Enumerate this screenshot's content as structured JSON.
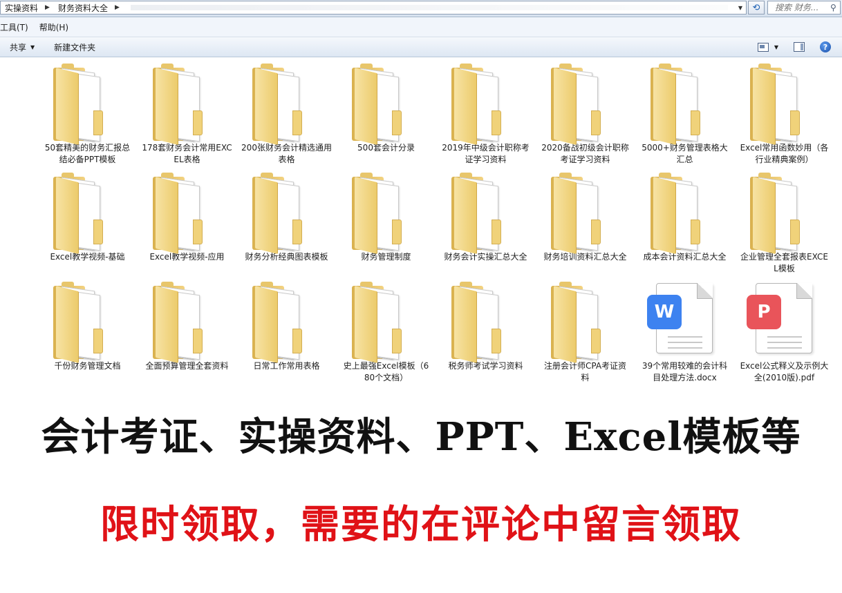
{
  "window": {
    "breadcrumbs": [
      "实操资料",
      "财务资料大全"
    ],
    "search_placeholder": "搜索 财务..."
  },
  "menubar": [
    "工具(T)",
    "帮助(H)"
  ],
  "toolbar": {
    "share_label": "共享",
    "new_folder_label": "新建文件夹"
  },
  "items": [
    {
      "label": "50套精美的财务汇报总结必备PPT模板",
      "type": "folder"
    },
    {
      "label": "178套财务会计常用EXCEL表格",
      "type": "folder"
    },
    {
      "label": "200张财务会计精选通用表格",
      "type": "folder"
    },
    {
      "label": "500套会计分录",
      "type": "folder"
    },
    {
      "label": "2019年中级会计职称考证学习资料",
      "type": "folder"
    },
    {
      "label": "2020备战初级会计职称考证学习资料",
      "type": "folder"
    },
    {
      "label": "5000+财务管理表格大汇总",
      "type": "folder"
    },
    {
      "label": "Excel常用函数妙用（各行业精典案例）",
      "type": "folder"
    },
    {
      "label": "Excel教学视频-基础",
      "type": "folder"
    },
    {
      "label": "Excel教学视频-应用",
      "type": "folder"
    },
    {
      "label": "财务分析经典图表模板",
      "type": "folder"
    },
    {
      "label": "财务管理制度",
      "type": "folder"
    },
    {
      "label": "财务会计实操汇总大全",
      "type": "folder"
    },
    {
      "label": "财务培训资料汇总大全",
      "type": "folder"
    },
    {
      "label": "成本会计资料汇总大全",
      "type": "folder"
    },
    {
      "label": "企业管理全套报表EXCEL模板",
      "type": "folder"
    },
    {
      "label": "千份财务管理文档",
      "type": "folder"
    },
    {
      "label": "全面预算管理全套资料",
      "type": "folder"
    },
    {
      "label": "日常工作常用表格",
      "type": "folder"
    },
    {
      "label": "史上最强Excel模板（680个文档）",
      "type": "folder"
    },
    {
      "label": "税务师考试学习资料",
      "type": "folder"
    },
    {
      "label": "注册会计师CPA考证资料",
      "type": "folder"
    },
    {
      "label": "39个常用较难的会计科目处理方法.docx",
      "type": "docx"
    },
    {
      "label": "Excel公式释义及示例大全(2010版).pdf",
      "type": "pdf"
    }
  ],
  "banner": {
    "headline": "会计考证、实操资料、PPT、Excel模板等",
    "cta": "限时领取，需要的在评论中留言领取"
  },
  "colors": {
    "cta_red": "#e01217",
    "headline_black": "#111111",
    "folder_yellow": "#f3d382",
    "word_blue": "#3d82f0",
    "pdf_red": "#e9545a"
  }
}
